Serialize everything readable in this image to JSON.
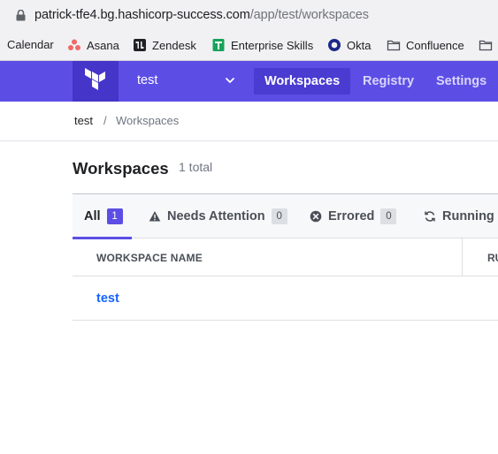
{
  "browser": {
    "url_host": "patrick-tfe4.bg.hashicorp-success.com",
    "url_path": "/app/test/workspaces",
    "bookmarks": [
      {
        "label": "Calendar",
        "icon": "none"
      },
      {
        "label": "Asana",
        "icon": "asana-icon"
      },
      {
        "label": "Zendesk",
        "icon": "zendesk-icon"
      },
      {
        "label": "Enterprise Skills",
        "icon": "sheets-icon"
      },
      {
        "label": "Okta",
        "icon": "okta-icon"
      },
      {
        "label": "Confluence",
        "icon": "folder-icon"
      },
      {
        "label": "",
        "icon": "folder-icon"
      }
    ]
  },
  "header": {
    "org_name": "test",
    "nav": [
      "Workspaces",
      "Registry",
      "Settings"
    ],
    "active_nav": "Workspaces",
    "brand_color": "#5c4ee5"
  },
  "breadcrumb": {
    "org": "test",
    "separator": "/",
    "current": "Workspaces"
  },
  "page": {
    "title": "Workspaces",
    "total": "1 total"
  },
  "tabs": [
    {
      "label": "All",
      "count": "1",
      "icon": "none",
      "active": true
    },
    {
      "label": "Needs Attention",
      "count": "0",
      "icon": "warning-icon"
    },
    {
      "label": "Errored",
      "count": "0",
      "icon": "error-icon"
    },
    {
      "label": "Running",
      "count": "",
      "icon": "refresh-icon"
    }
  ],
  "table": {
    "columns": [
      "WORKSPACE NAME",
      "RU"
    ],
    "rows": [
      {
        "name": "test"
      }
    ]
  }
}
